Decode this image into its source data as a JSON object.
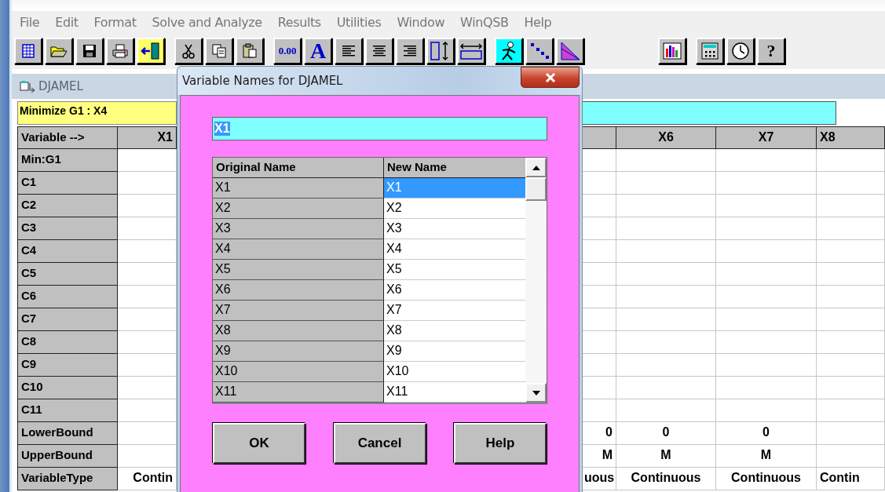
{
  "menu": [
    "File",
    "Edit",
    "Format",
    "Solve and Analyze",
    "Results",
    "Utilities",
    "Window",
    "WinQSB",
    "Help"
  ],
  "toolbar": [
    [
      {
        "kind": "grid"
      },
      {
        "kind": "open"
      },
      {
        "kind": "save"
      },
      {
        "kind": "print"
      },
      {
        "kind": "exit"
      }
    ],
    [
      {
        "kind": "cut"
      },
      {
        "kind": "copy"
      },
      {
        "kind": "paste"
      }
    ],
    [
      {
        "kind": "decimal",
        "label": "0.00"
      },
      {
        "kind": "font",
        "label": "A"
      },
      {
        "kind": "align-left"
      },
      {
        "kind": "align-center"
      },
      {
        "kind": "align-right"
      },
      {
        "kind": "row-height"
      },
      {
        "kind": "column-width"
      }
    ],
    [
      {
        "kind": "solve"
      },
      {
        "kind": "dots"
      },
      {
        "kind": "triangle"
      }
    ],
    [
      {
        "kind": "chart"
      }
    ],
    [
      {
        "kind": "calculator"
      },
      {
        "kind": "clock"
      },
      {
        "kind": "help",
        "label": "?"
      }
    ]
  ],
  "document": {
    "title": "DJAMEL",
    "objective": "Minimize G1 : X4",
    "corner": "Variable -->",
    "columns": {
      "column_1": "X1",
      "column_3": "X6",
      "column_4": "X7",
      "column_5": "X8"
    },
    "rows": [
      {
        "label": "Min:G1"
      },
      {
        "label": "C1"
      },
      {
        "label": "C2"
      },
      {
        "label": "C3"
      },
      {
        "label": "C4"
      },
      {
        "label": "C5"
      },
      {
        "label": "C6"
      },
      {
        "label": "C7"
      },
      {
        "label": "C8"
      },
      {
        "label": "C9"
      },
      {
        "label": "C10"
      },
      {
        "label": "C11"
      },
      {
        "label": "LowerBound",
        "column_2": "0",
        "column_3": "0",
        "column_4": "0"
      },
      {
        "label": "UpperBound",
        "column_2": "M",
        "column_3": "M",
        "column_4": "M"
      },
      {
        "label": "VariableType",
        "column_1": "Contin",
        "column_2": "uous",
        "column_3": "Continuous",
        "column_4": "Continuous",
        "column_5": "Contin"
      }
    ]
  },
  "dialog": {
    "title": "Variable Names for DJAMEL",
    "name_field": {
      "value": "X1"
    },
    "table": {
      "columns": [
        "Original Name",
        "New Name"
      ],
      "rows": [
        {
          "original": "X1",
          "new": "X1",
          "selected": true
        },
        {
          "original": "X2",
          "new": "X2",
          "selected": false
        },
        {
          "original": "X3",
          "new": "X3",
          "selected": false
        },
        {
          "original": "X4",
          "new": "X4",
          "selected": false
        },
        {
          "original": "X5",
          "new": "X5",
          "selected": false
        },
        {
          "original": "X6",
          "new": "X6",
          "selected": false
        },
        {
          "original": "X7",
          "new": "X7",
          "selected": false
        },
        {
          "original": "X8",
          "new": "X8",
          "selected": false
        },
        {
          "original": "X9",
          "new": "X9",
          "selected": false
        },
        {
          "original": "X10",
          "new": "X10",
          "selected": false
        },
        {
          "original": "X11",
          "new": "X11",
          "selected": false
        }
      ]
    },
    "buttons": [
      "OK",
      "Cancel",
      "Help"
    ]
  }
}
